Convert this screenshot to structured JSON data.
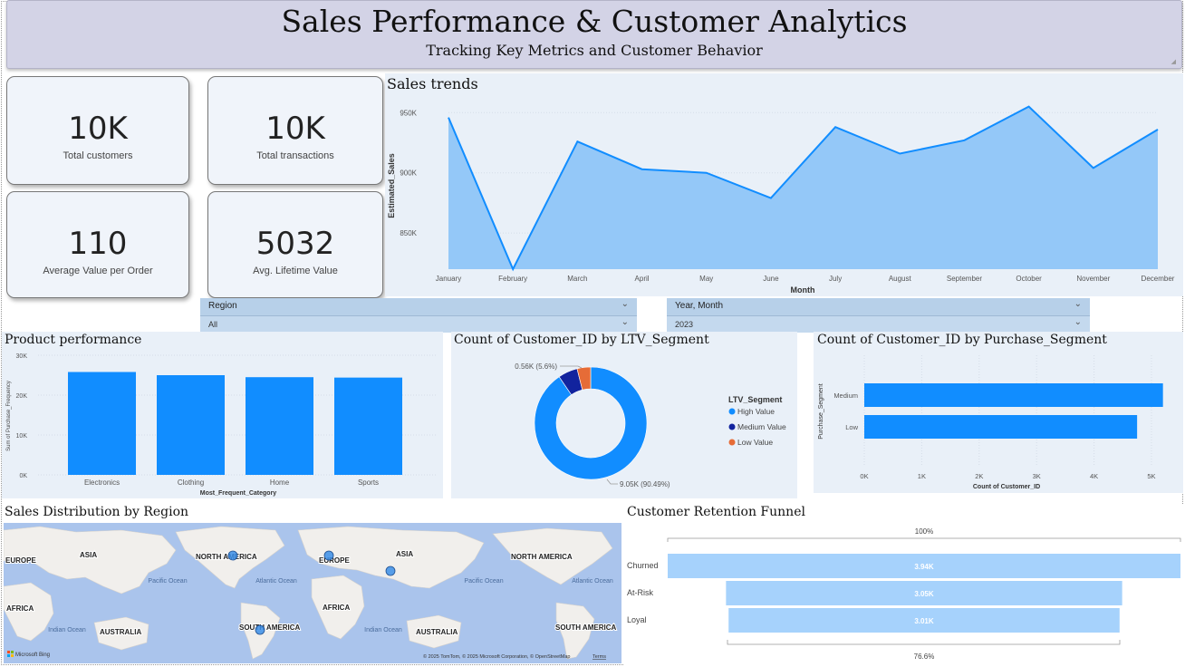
{
  "header": {
    "title": "Sales Performance & Customer Analytics",
    "subtitle": "Tracking Key Metrics and Customer Behavior"
  },
  "kpis": [
    {
      "value": "10K",
      "label": "Total customers"
    },
    {
      "value": "10K",
      "label": "Total transactions"
    },
    {
      "value": "110",
      "label": "Average Value per Order"
    },
    {
      "value": "5032",
      "label": "Avg. Lifetime Value"
    }
  ],
  "filters": {
    "region": {
      "label": "Region",
      "value": "All"
    },
    "year_month": {
      "label": "Year, Month",
      "value": "2023"
    }
  },
  "colors": {
    "accent": "#118dff",
    "area_fill": "#94c8f8",
    "dark_blue": "#12239e",
    "orange": "#e66c37",
    "funnel": "#a6d2fc",
    "header_bg": "#d3d3e6",
    "panel_bg": "#e9f0f8"
  },
  "map": {
    "title": "Sales Distribution by Region",
    "labels": {
      "north_america_1": "NORTH AMERICA",
      "north_america_2": "NORTH AMERICA",
      "south_america_1": "SOUTH AMERICA",
      "south_america_2": "SOUTH AMERICA",
      "europe_1": "EUROPE",
      "europe_2": "EUROPE",
      "asia_1": "ASIA",
      "asia_2": "ASIA",
      "africa_1": "AFRICA",
      "africa_2": "AFRICA",
      "australia_1": "AUSTRALIA",
      "australia_2": "AUSTRALIA",
      "pacific_1": "Pacific Ocean",
      "pacific_2": "Pacific Ocean",
      "atlantic_1": "Atlantic Ocean",
      "atlantic_2": "Atlantic Ocean",
      "indian_1": "Indian Ocean",
      "indian_2": "Indian Ocean"
    },
    "logo": "Microsoft Bing",
    "attribution": "© 2025 TomTom, © 2025 Microsoft Corporation, © OpenStreetMap",
    "terms": "Terms"
  },
  "chart_data": [
    {
      "id": "sales_trends",
      "type": "area",
      "title": "Sales trends",
      "xlabel": "Month",
      "ylabel": "Estimated_Sales",
      "x": [
        "January",
        "February",
        "March",
        "April",
        "May",
        "June",
        "July",
        "August",
        "September",
        "October",
        "November",
        "December"
      ],
      "values": [
        946000,
        820000,
        926000,
        903000,
        900000,
        879000,
        938000,
        916000,
        927000,
        955000,
        904000,
        936000
      ],
      "ylim": [
        820000,
        960000
      ],
      "yticks": [
        850000,
        900000,
        950000
      ],
      "ytick_labels": [
        "850K",
        "900K",
        "950K"
      ],
      "grid": true,
      "color": "#118dff"
    },
    {
      "id": "product_performance",
      "type": "bar",
      "title": "Product performance",
      "xlabel": "Most_Frequent_Category",
      "ylabel": "Sum of Purchase_Frequency",
      "categories": [
        "Electronics",
        "Clothing",
        "Home",
        "Sports"
      ],
      "values": [
        25800,
        25000,
        24500,
        24400
      ],
      "ylim": [
        0,
        30000
      ],
      "yticks": [
        0,
        10000,
        20000,
        30000
      ],
      "ytick_labels": [
        "0K",
        "10K",
        "20K",
        "30K"
      ],
      "color": "#118dff"
    },
    {
      "id": "ltv_segment",
      "type": "pie",
      "title": "Count of Customer_ID by LTV_Segment",
      "legend_title": "LTV_Segment",
      "legend_position": "right",
      "categories": [
        "High Value",
        "Medium Value",
        "Low Value"
      ],
      "values": [
        9050,
        560,
        390
      ],
      "colors": [
        "#118dff",
        "#12239e",
        "#e66c37"
      ],
      "data_labels": [
        "9.05K (90.49%)",
        "0.56K (5.6%)"
      ]
    },
    {
      "id": "purchase_segment",
      "type": "bar",
      "orientation": "horizontal",
      "title": "Count of Customer_ID by Purchase_Segment",
      "xlabel": "Count of Customer_ID",
      "ylabel": "Purchase_Segment",
      "categories": [
        "Medium",
        "Low"
      ],
      "values": [
        5200,
        4750
      ],
      "xlim": [
        0,
        5300
      ],
      "xticks": [
        0,
        1000,
        2000,
        3000,
        4000,
        5000
      ],
      "xtick_labels": [
        "0K",
        "1K",
        "2K",
        "3K",
        "4K",
        "5K"
      ],
      "color": "#118dff"
    },
    {
      "id": "retention_funnel",
      "type": "bar",
      "subtype": "funnel",
      "title": "Customer Retention Funnel",
      "categories": [
        "Churned",
        "At-Risk",
        "Loyal"
      ],
      "values": [
        3940,
        3050,
        3010
      ],
      "value_labels": [
        "3.94K",
        "3.05K",
        "3.01K"
      ],
      "top_label": "100%",
      "bottom_label": "76.6%",
      "color": "#a6d2fc"
    }
  ]
}
